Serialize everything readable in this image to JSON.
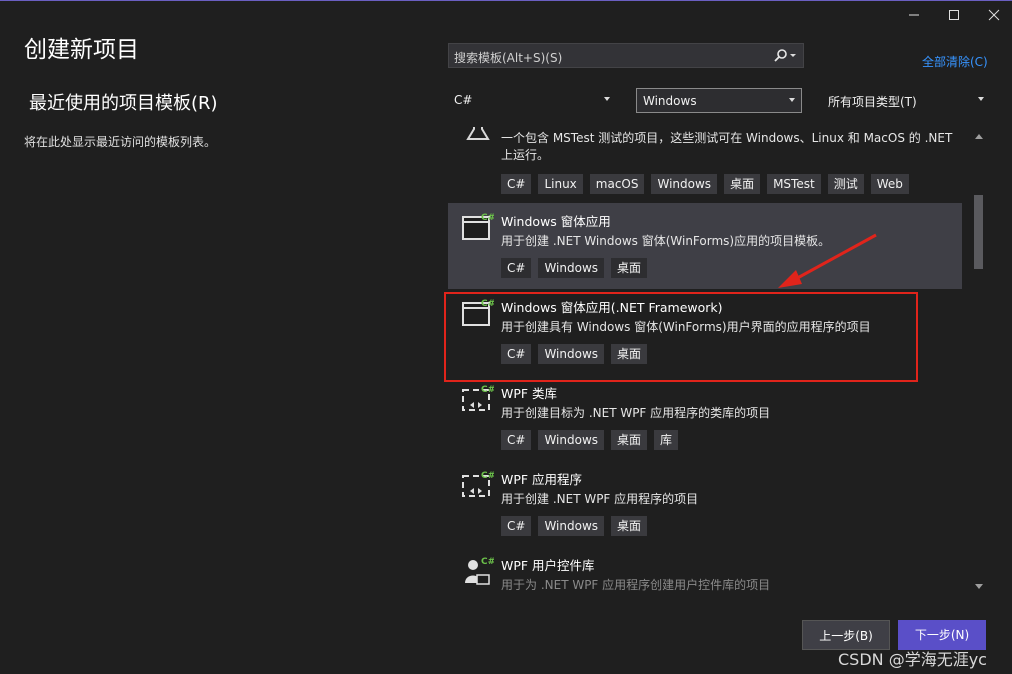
{
  "window": {
    "minimize_label": "—",
    "maximize_label": "□",
    "close_label": "×"
  },
  "page": {
    "title": "创建新项目",
    "recent_title": "最近使用的项目模板(R)",
    "recent_empty": "将在此处显示最近访问的模板列表。"
  },
  "search": {
    "placeholder": "搜索模板(Alt+S)(S)",
    "icon": "search-icon"
  },
  "clear_all": "全部清除(C)",
  "filters": {
    "language": "C#",
    "platform": "Windows",
    "project_type": "所有项目类型(T)"
  },
  "templates": [
    {
      "name": "",
      "desc": "一个包含 MSTest 测试的项目，这些测试可在 Windows、Linux 和 MacOS 的 .NET",
      "desc2": "上运行。",
      "tags": [
        "C#",
        "Linux",
        "macOS",
        "Windows",
        "桌面",
        "MSTest",
        "测试",
        "Web"
      ]
    },
    {
      "name": "Windows 窗体应用",
      "desc": "用于创建 .NET Windows 窗体(WinForms)应用的项目模板。",
      "tags": [
        "C#",
        "Windows",
        "桌面"
      ],
      "selected": true
    },
    {
      "name": "Windows 窗体应用(.NET Framework)",
      "desc": "用于创建具有 Windows 窗体(WinForms)用户界面的应用程序的项目",
      "tags": [
        "C#",
        "Windows",
        "桌面"
      ]
    },
    {
      "name": "WPF 类库",
      "desc": "用于创建目标为 .NET WPF 应用程序的类库的项目",
      "tags": [
        "C#",
        "Windows",
        "桌面",
        "库"
      ]
    },
    {
      "name": "WPF 应用程序",
      "desc": "用于创建 .NET WPF 应用程序的项目",
      "tags": [
        "C#",
        "Windows",
        "桌面"
      ]
    },
    {
      "name": "WPF 用户控件库",
      "desc": "用于为 .NET WPF 应用程序创建用户控件库的项目",
      "tags": []
    }
  ],
  "buttons": {
    "back": "上一步(B)",
    "next": "下一步(N)"
  },
  "watermark": "CSDN @学海无涯yc",
  "colors": {
    "accent": "#5a4fc8",
    "link": "#3794ff",
    "annotation": "#e0241b",
    "background": "#1f1f1f"
  }
}
